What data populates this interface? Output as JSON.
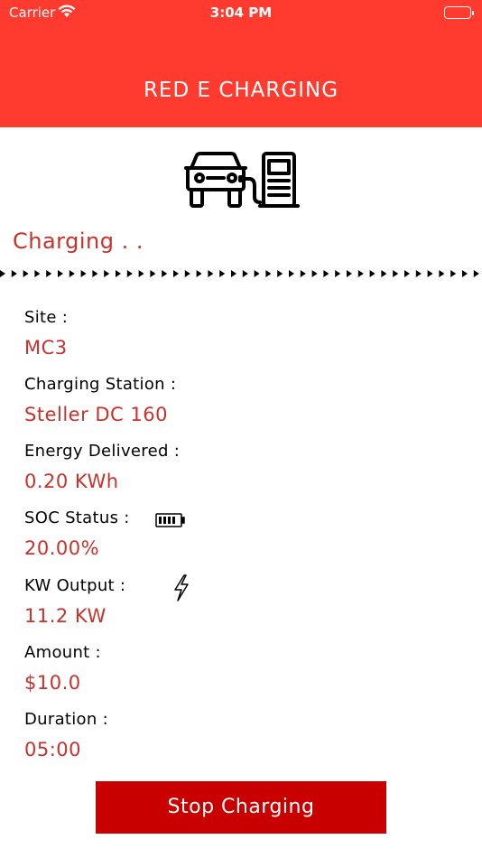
{
  "status_bar": {
    "carrier": "Carrier",
    "time": "3:04 PM"
  },
  "header": {
    "title": "RED E CHARGING",
    "color": "#ff3b30"
  },
  "charging_status": "Charging . .",
  "fields": {
    "site": {
      "label": "Site :",
      "value": "MC3"
    },
    "charging_station": {
      "label": "Charging Station :",
      "value": "Steller DC 160"
    },
    "energy_delivered": {
      "label": "Energy Delivered :",
      "value": "0.20 KWh"
    },
    "soc_status": {
      "label": "SOC Status :",
      "value": "20.00%"
    },
    "kw_output": {
      "label": "KW Output :",
      "value": "11.2 KW"
    },
    "amount": {
      "label": "Amount :",
      "value": "$10.0"
    },
    "duration": {
      "label": "Duration :",
      "value": "05:00"
    }
  },
  "stop_button": {
    "label": "Stop Charging",
    "color": "#c80000"
  },
  "icons": [
    "wifi-icon",
    "battery-icon",
    "ev-station-icon",
    "soc-battery-icon",
    "lightning-bolt-icon"
  ]
}
